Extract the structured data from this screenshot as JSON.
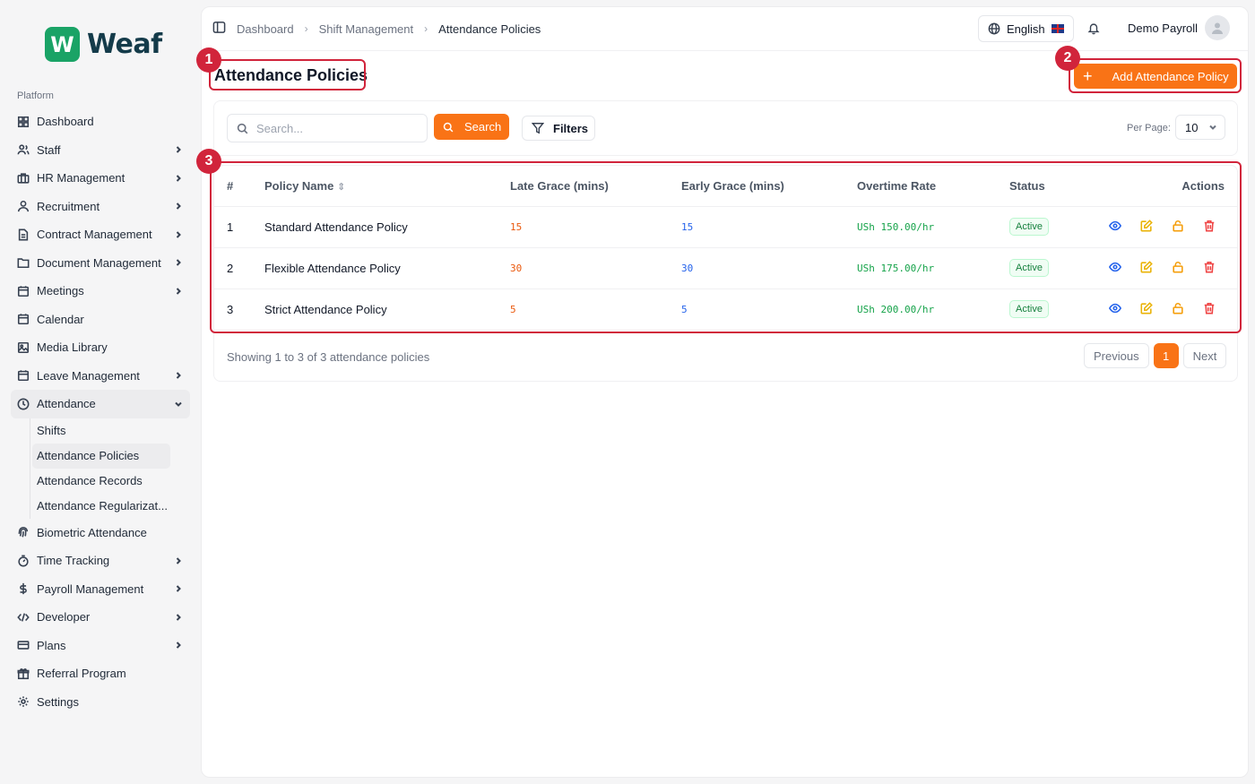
{
  "brand": {
    "logo_letter": "W",
    "name": "Weaf",
    "color": "#1aa366"
  },
  "sidebar": {
    "section_label": "Platform",
    "items": [
      {
        "label": "Dashboard",
        "icon": "dashboard-icon",
        "chevron": false
      },
      {
        "label": "Staff",
        "icon": "users-icon",
        "chevron": true
      },
      {
        "label": "HR Management",
        "icon": "briefcase-icon",
        "chevron": true
      },
      {
        "label": "Recruitment",
        "icon": "user-icon",
        "chevron": true
      },
      {
        "label": "Contract Management",
        "icon": "file-icon",
        "chevron": true
      },
      {
        "label": "Document Management",
        "icon": "folder-icon",
        "chevron": true
      },
      {
        "label": "Meetings",
        "icon": "calendar-icon",
        "chevron": true
      },
      {
        "label": "Calendar",
        "icon": "calendar-icon",
        "chevron": false
      },
      {
        "label": "Media Library",
        "icon": "image-icon",
        "chevron": false
      },
      {
        "label": "Leave Management",
        "icon": "calendar-icon",
        "chevron": true
      },
      {
        "label": "Attendance",
        "icon": "clock-icon",
        "chevron": true,
        "expanded": true
      }
    ],
    "attendance_subitems": [
      {
        "label": "Shifts"
      },
      {
        "label": "Attendance Policies",
        "active": true
      },
      {
        "label": "Attendance Records"
      },
      {
        "label": "Attendance Regularizat..."
      }
    ],
    "items_after": [
      {
        "label": "Biometric Attendance",
        "icon": "fingerprint-icon",
        "chevron": false
      },
      {
        "label": "Time Tracking",
        "icon": "timer-icon",
        "chevron": true
      },
      {
        "label": "Payroll Management",
        "icon": "dollar-icon",
        "chevron": true
      },
      {
        "label": "Developer",
        "icon": "code-icon",
        "chevron": true
      },
      {
        "label": "Plans",
        "icon": "card-icon",
        "chevron": true
      },
      {
        "label": "Referral Program",
        "icon": "gift-icon",
        "chevron": false
      },
      {
        "label": "Settings",
        "icon": "gear-icon",
        "chevron": false
      }
    ]
  },
  "header": {
    "breadcrumbs": [
      "Dashboard",
      "Shift Management",
      "Attendance Policies"
    ],
    "language": "English",
    "user_name": "Demo Payroll"
  },
  "page": {
    "title": "Attendance Policies",
    "add_button": "Add Attendance Policy",
    "search_placeholder": "Search...",
    "search_button": "Search",
    "filters_button": "Filters",
    "per_page_label": "Per Page:",
    "per_page_value": "10"
  },
  "table": {
    "columns": [
      "#",
      "Policy Name",
      "Late Grace (mins)",
      "Early Grace (mins)",
      "Overtime Rate",
      "Status",
      "Actions"
    ],
    "rows": [
      {
        "num": "1",
        "name": "Standard Attendance Policy",
        "late": "15",
        "early": "15",
        "rate": "USh 150.00/hr",
        "status": "Active"
      },
      {
        "num": "2",
        "name": "Flexible Attendance Policy",
        "late": "30",
        "early": "30",
        "rate": "USh 175.00/hr",
        "status": "Active"
      },
      {
        "num": "3",
        "name": "Strict Attendance Policy",
        "late": "5",
        "early": "5",
        "rate": "USh 200.00/hr",
        "status": "Active"
      }
    ],
    "footer_text": "Showing 1 to 3 of 3 attendance policies",
    "pager": {
      "previous": "Previous",
      "current": "1",
      "next": "Next"
    }
  },
  "annotations": {
    "markers": [
      "1",
      "2",
      "3"
    ],
    "color": "#d1243b"
  },
  "colors": {
    "accent": "#f97316"
  }
}
